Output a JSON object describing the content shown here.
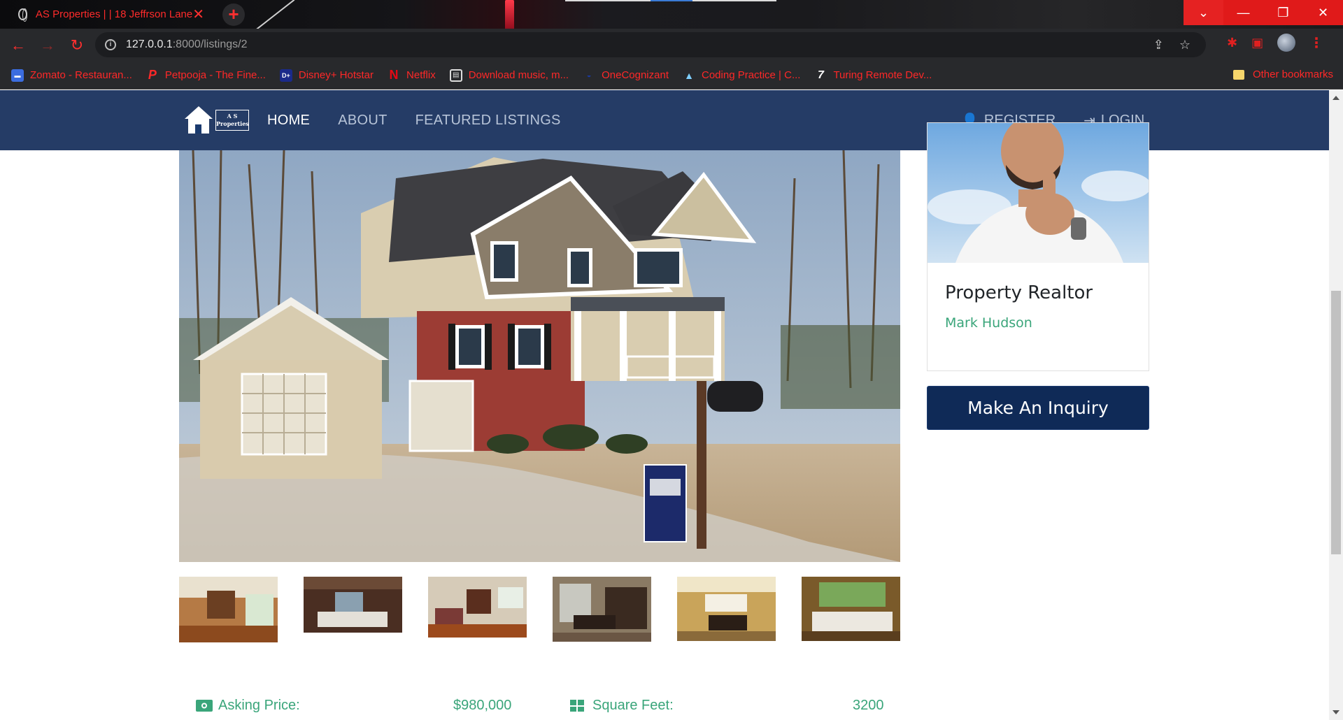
{
  "browser": {
    "tab_title": "AS Properties | | 18 Jeffrson Lane",
    "url_host": "127.0.0.1",
    "url_path": ":8000/listings/2",
    "bookmarks": [
      {
        "label": "Zomato - Restauran...",
        "icon": "zomato-icon",
        "color": "#3b6de0"
      },
      {
        "label": "Petpooja - The Fine...",
        "icon": "petpooja-icon",
        "color": "#ff2828"
      },
      {
        "label": "Disney+ Hotstar",
        "icon": "hotstar-icon",
        "color": "#1a2a8a"
      },
      {
        "label": "Netflix",
        "icon": "netflix-icon",
        "color": "#e50914"
      },
      {
        "label": "Download music, m...",
        "icon": "download-icon",
        "color": "#dddddd"
      },
      {
        "label": "OneCognizant",
        "icon": "cognizant-icon",
        "color": "#1a3aa0"
      },
      {
        "label": "Coding Practice | C...",
        "icon": "coding-icon",
        "color": "#7fd0ff"
      },
      {
        "label": "Turing Remote Dev...",
        "icon": "turing-icon",
        "color": "#ffffff"
      }
    ],
    "other_bookmarks": "Other bookmarks"
  },
  "nav": {
    "brand_line1": "A S",
    "brand_line2": "Properties",
    "links": [
      "HOME",
      "ABOUT",
      "FEATURED LISTINGS"
    ],
    "register": "REGISTER",
    "login": "LOGIN"
  },
  "realtor": {
    "title": "Property Realtor",
    "name": "Mark Hudson"
  },
  "inquiry_button": "Make An Inquiry",
  "details": {
    "asking_price_label": "Asking Price:",
    "asking_price_value": "$980,000",
    "square_feet_label": "Square Feet:",
    "square_feet_value": "3200"
  },
  "colors": {
    "accent_green": "#3aa57a",
    "navbar": "#142d5a",
    "button": "#0f2a57",
    "chrome_red": "#ff2828"
  }
}
